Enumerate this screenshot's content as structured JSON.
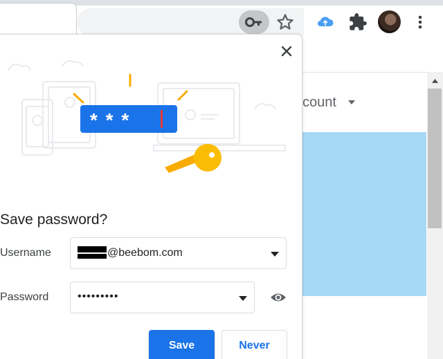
{
  "browser": {
    "tab_title_fragment": "o",
    "icons": [
      "key-icon",
      "star-icon",
      "cloud-extension-icon",
      "puzzle-extension-icon",
      "profile-avatar",
      "more-menu-icon"
    ]
  },
  "page": {
    "account_text": "count",
    "panel_color": "#a7d9f6"
  },
  "dialog": {
    "title": "Save password?",
    "password_mask_illustration": "* * *",
    "username": {
      "label": "Username",
      "value": "@beebom.com"
    },
    "password": {
      "label": "Password",
      "value": "•••••••••"
    },
    "buttons": {
      "save": "Save",
      "never": "Never"
    }
  },
  "colors": {
    "accent": "#1a73e8",
    "key_yellow": "#f9ab00"
  }
}
